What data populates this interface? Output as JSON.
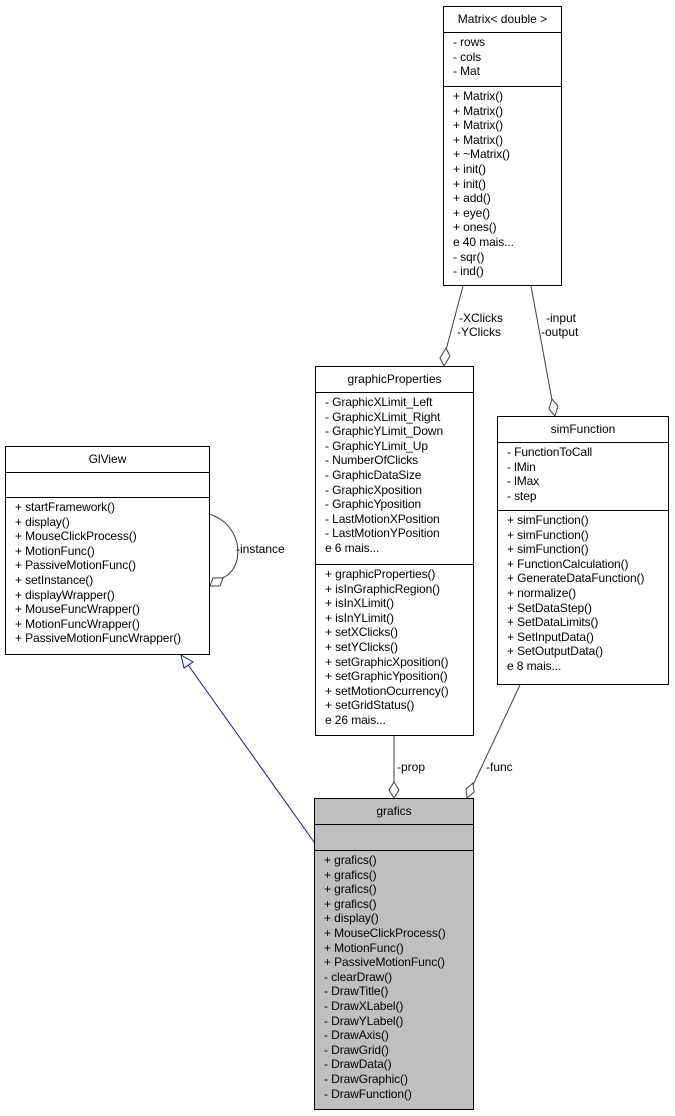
{
  "classes": {
    "matrix": {
      "name": "Matrix< double >",
      "attributes": [
        "- rows",
        "- cols",
        "- Mat"
      ],
      "methods": [
        "+ Matrix()",
        "+ Matrix()",
        "+ Matrix()",
        "+ Matrix()",
        "+ ~Matrix()",
        "+ init()",
        "+ init()",
        "+ add()",
        "+ eye()",
        "+ ones()",
        "e 40 mais...",
        "- sqr()",
        "- ind()"
      ]
    },
    "graphicProperties": {
      "name": "graphicProperties",
      "attributes": [
        "- GraphicXLimit_Left",
        "- GraphicXLimit_Right",
        "- GraphicYLimit_Down",
        "- GraphicYLimit_Up",
        "- NumberOfClicks",
        "- GraphicDataSize",
        "- GraphicXposition",
        "- GraphicYposition",
        "- LastMotionXPosition",
        "- LastMotionYPosition",
        "e 6 mais..."
      ],
      "methods": [
        "+ graphicProperties()",
        "+ isInGraphicRegion()",
        "+ isInXLimit()",
        "+ isInYLimit()",
        "+ setXClicks()",
        "+ setYClicks()",
        "+ setGraphicXposition()",
        "+ setGraphicYposition()",
        "+ setMotionOcurrency()",
        "+ setGridStatus()",
        "e 26 mais..."
      ]
    },
    "simFunction": {
      "name": "simFunction",
      "attributes": [
        "- FunctionToCall",
        "- lMin",
        "- lMax",
        "- step"
      ],
      "methods": [
        "+ simFunction()",
        "+ simFunction()",
        "+ simFunction()",
        "+ FunctionCalculation()",
        "+ GenerateDataFunction()",
        "+ normalize()",
        "+ SetDataStep()",
        "+ SetDataLimits()",
        "+ SetInputData()",
        "+ SetOutputData()",
        "e 8 mais..."
      ]
    },
    "glView": {
      "name": "GlView",
      "attributes": [],
      "methods": [
        "+ startFramework()",
        "+ display()",
        "+ MouseClickProcess()",
        "+ MotionFunc()",
        "+ PassiveMotionFunc()",
        "+ setInstance()",
        "+ displayWrapper()",
        "+ MouseFuncWrapper()",
        "+ MotionFuncWrapper()",
        "+ PassiveMotionFuncWrapper()"
      ]
    },
    "grafics": {
      "name": "grafics",
      "attributes": [],
      "methods": [
        "+ grafics()",
        "+ grafics()",
        "+ grafics()",
        "+ grafics()",
        "+ display()",
        "+ MouseClickProcess()",
        "+ MotionFunc()",
        "+ PassiveMotionFunc()",
        "- clearDraw()",
        "- DrawTitle()",
        "- DrawXLabel()",
        "- DrawYLabel()",
        "- DrawAxis()",
        "- DrawGrid()",
        "- DrawData()",
        "- DrawGraphic()",
        "- DrawFunction()"
      ]
    }
  },
  "edges": {
    "xclicks": "-XClicks",
    "yclicks": "-YClicks",
    "input": "-input",
    "output": "-output",
    "instance": "-instance",
    "prop": "-prop",
    "func": "-func"
  },
  "colors": {
    "highlight": "#bfbfbf",
    "inheritance": "#191970",
    "association": "#404040"
  }
}
